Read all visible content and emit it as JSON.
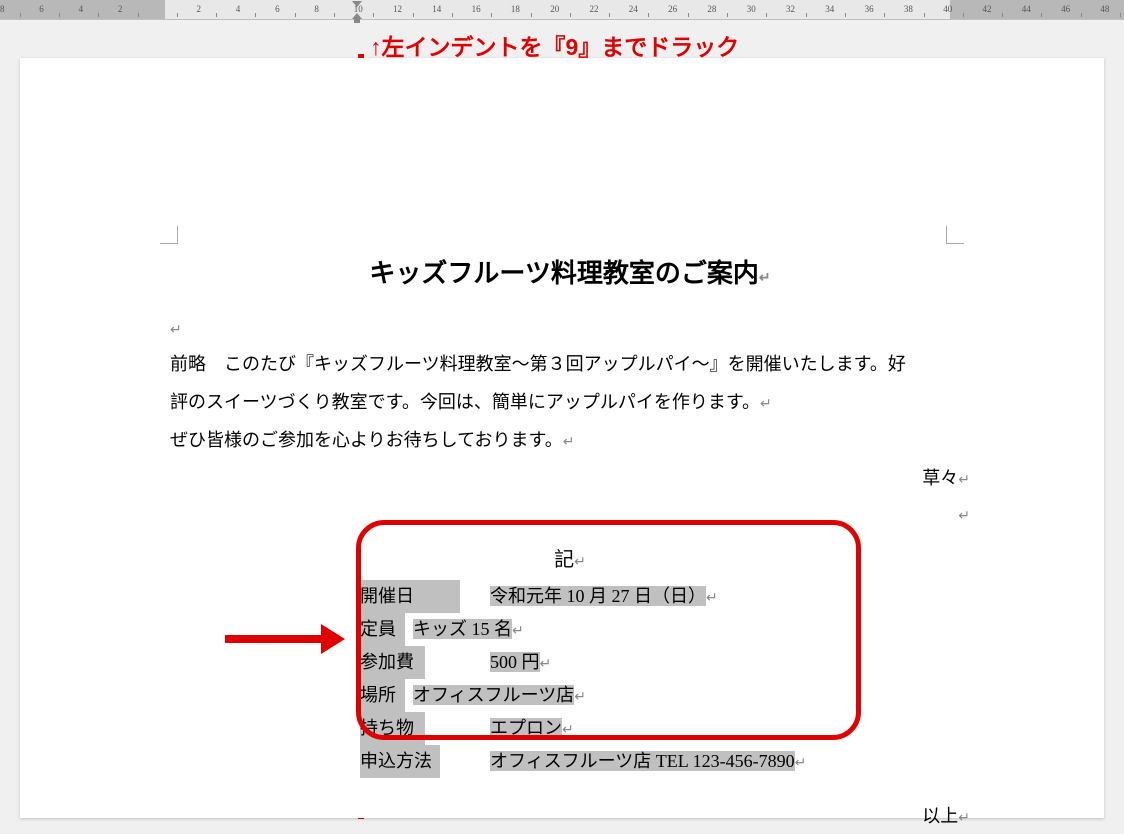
{
  "ruler": {
    "numbers": [
      "8",
      "6",
      "4",
      "2",
      "",
      "2",
      "4",
      "6",
      "8",
      "10",
      "12",
      "14",
      "16",
      "18",
      "20",
      "22",
      "24",
      "26",
      "28",
      "30",
      "32",
      "34",
      "36",
      "38",
      "40",
      "42",
      "44",
      "46",
      "48"
    ],
    "indent_target": "9"
  },
  "annotation": "↑左インデントを『9』までドラック",
  "document": {
    "title": "キッズフルーツ料理教室のご案内",
    "body_lines": [
      "前略　このたび『キッズフルーツ料理教室〜第３回アップルパイ〜』を開催いたします。好",
      "評のスイーツづくり教室です。今回は、簡単にアップルパイを作ります。",
      "ぜひ皆様のご参加を心よりお待ちしております。"
    ],
    "closing": "草々",
    "ki": "記",
    "details": [
      {
        "label": "開催日",
        "value": "令和元年 10 月 27 日（日）"
      },
      {
        "label": "定員",
        "value": "キッズ 15 名"
      },
      {
        "label": "参加費",
        "value": "500 円"
      },
      {
        "label": "場所",
        "value": "オフィスフルーツ店"
      },
      {
        "label": "持ち物",
        "value": "エプロン"
      },
      {
        "label": "申込方法",
        "value": "オフィスフルーツ店 TEL 123-456-7890"
      }
    ],
    "ijyou": "以上"
  },
  "para_mark": "↵"
}
